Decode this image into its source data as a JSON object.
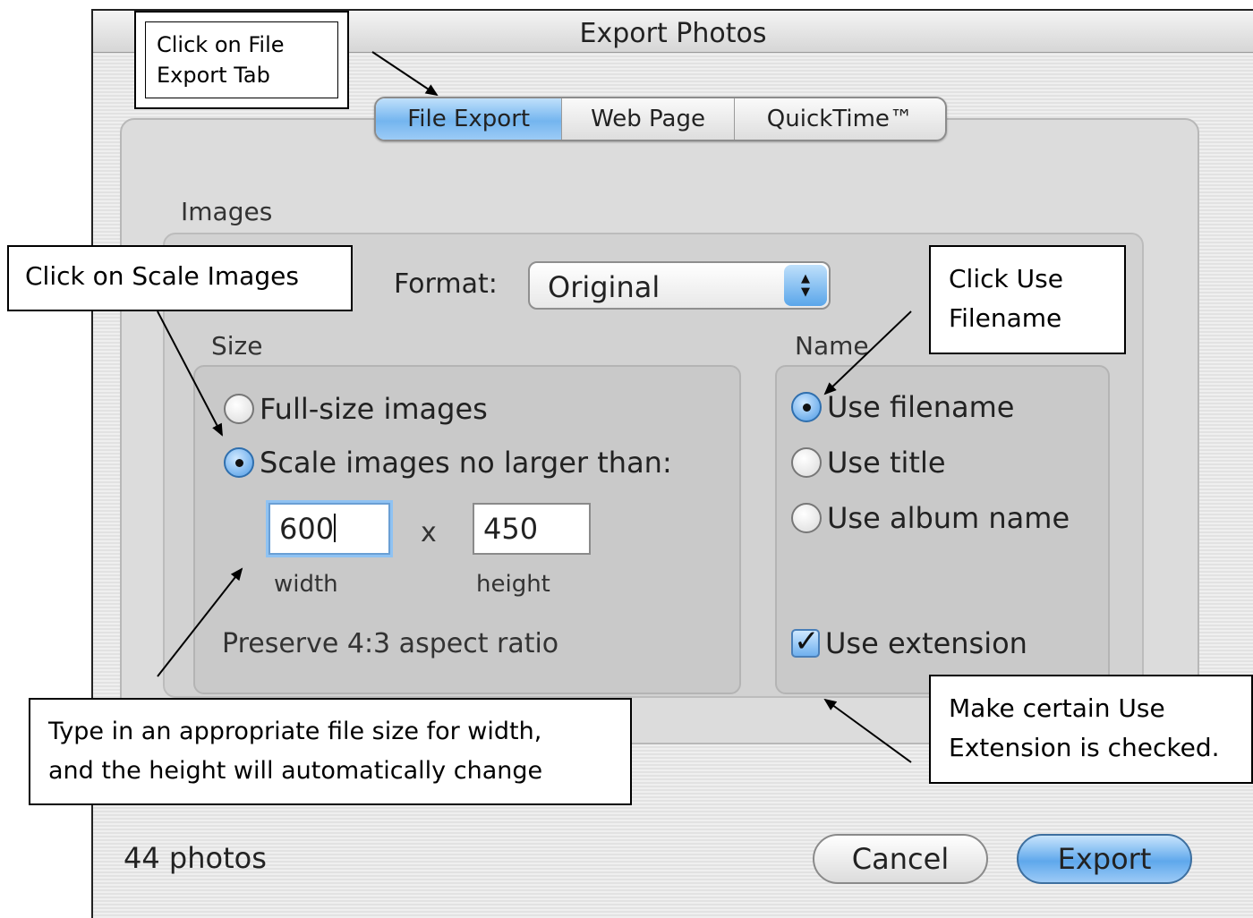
{
  "window": {
    "title": "Export Photos"
  },
  "tabs": [
    {
      "label": "File Export"
    },
    {
      "label": "Web Page"
    },
    {
      "label": "QuickTime™"
    }
  ],
  "images_group": {
    "label": "Images",
    "format_label": "Format:",
    "format_value": "Original"
  },
  "size": {
    "label": "Size",
    "full_size": "Full-size images",
    "scale": "Scale images no larger than:",
    "width_value": "600",
    "height_value": "450",
    "times": "x",
    "width_label": "width",
    "height_label": "height",
    "aspect": "Preserve 4:3 aspect ratio"
  },
  "name": {
    "label": "Name",
    "use_filename": "Use filename",
    "use_title": "Use title",
    "use_album": "Use album name",
    "use_extension": "Use extension"
  },
  "footer": {
    "count": "44 photos",
    "cancel": "Cancel",
    "export": "Export"
  },
  "annotations": {
    "file_export_tab": "Click on File\nExport Tab",
    "scale_images": "Click on Scale Images",
    "use_filename": "Click Use\nFilename",
    "width_hint": "Type in an appropriate file size for width,\nand the height will automatically change",
    "extension": "Make certain Use\nExtension is checked."
  }
}
